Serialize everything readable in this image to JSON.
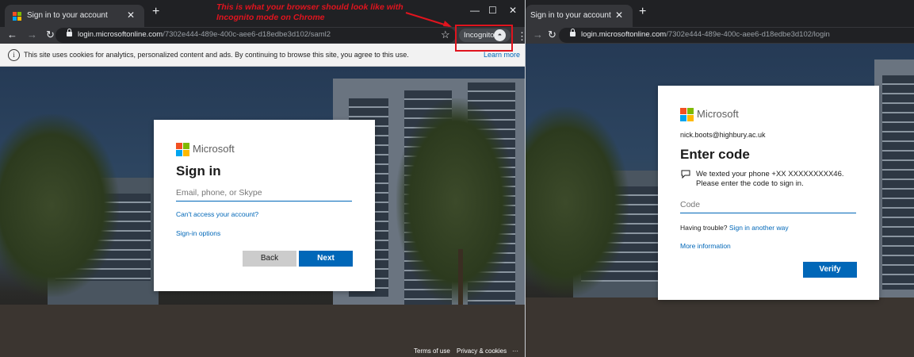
{
  "left_browser": {
    "tab_title": "Sign in to your account",
    "url_host": "login.microsoftonline.com",
    "url_path": "/7302e444-489e-400c-aee6-d18edbe3d102/saml2",
    "incognito_label": "Incognito",
    "cookie_banner": {
      "message": "This site uses cookies for analytics, personalized content and ads. By continuing to browse this site, you agree to this use.",
      "learn_more": "Learn more"
    },
    "signin": {
      "brand": "Microsoft",
      "heading": "Sign in",
      "email_placeholder": "Email, phone, or Skype",
      "cant_access": "Can't access your account?",
      "signin_options": "Sign-in options",
      "back": "Back",
      "next": "Next"
    },
    "footer": {
      "terms": "Terms of use",
      "privacy": "Privacy & cookies",
      "more": "···"
    }
  },
  "annotation": {
    "text": "This is what your browser should look like with Incognito mode on Chrome",
    "color": "#e0141e"
  },
  "right_browser": {
    "tab_title": "Sign in to your account",
    "url_host": "login.microsoftonline.com",
    "url_path": "/7302e444-489e-400c-aee6-d18edbe3d102/login",
    "code_card": {
      "brand": "Microsoft",
      "account": "nick.boots@highbury.ac.uk",
      "heading": "Enter code",
      "message_line1": "We texted your phone +XX XXXXXXXXX46.",
      "message_line2": "Please enter the code to sign in.",
      "code_placeholder": "Code",
      "trouble_prefix": "Having trouble?",
      "trouble_link": "Sign in another way",
      "more_info": "More information",
      "verify": "Verify"
    }
  },
  "colors": {
    "ms_red": "#f25022",
    "ms_green": "#7fba00",
    "ms_blue": "#00a4ef",
    "ms_yellow": "#ffb900",
    "link_blue": "#0067b8",
    "chrome_dark": "#202124"
  },
  "icons": [
    "back-arrow-icon",
    "forward-arrow-icon",
    "reload-icon",
    "lock-icon",
    "star-icon",
    "incognito-icon",
    "kebab-icon",
    "info-icon",
    "message-icon",
    "close-icon",
    "plus-icon",
    "minimize-icon",
    "maximize-icon"
  ]
}
